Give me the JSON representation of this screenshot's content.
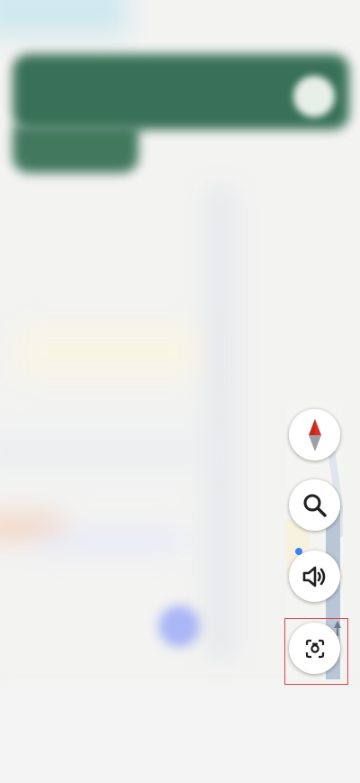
{
  "map": {
    "banner_color": "#2f6b4f",
    "location_color": "#3b82f6"
  },
  "controls": {
    "compass": {
      "icon": "compass-icon",
      "north_color": "#d93025"
    },
    "search": {
      "icon": "search-icon"
    },
    "sound": {
      "icon": "volume-icon"
    },
    "lens": {
      "icon": "camera-lens-icon"
    }
  },
  "highlight": {
    "color": "#e0404a"
  }
}
